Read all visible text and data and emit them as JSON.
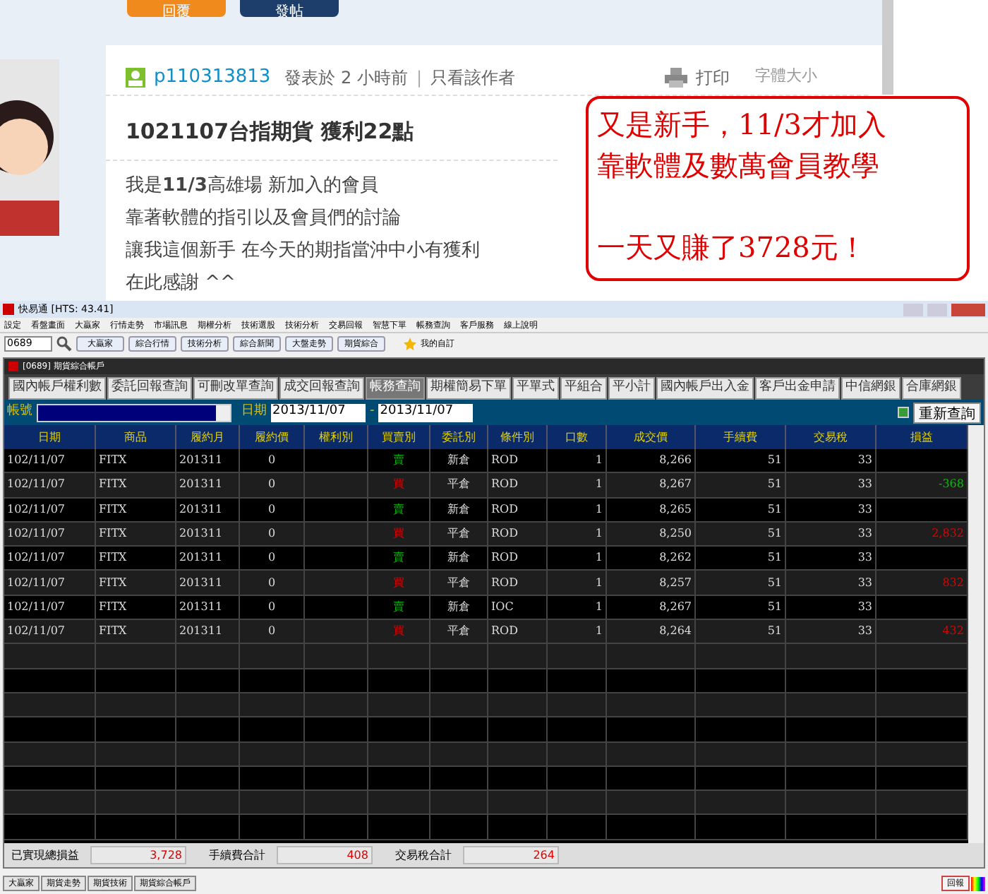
{
  "forum": {
    "buttons": [
      "回覆",
      "發帖"
    ],
    "post": {
      "author": "p110313813",
      "posted": "發表於 2 小時前",
      "divider": "|",
      "author_only": "只看該作者",
      "print": "打印",
      "font_size": "字體大小",
      "title": "1021107台指期貨 獲利22點",
      "body": [
        "我是**11/3**高雄場 新加入的會員",
        "靠著軟體的指引以及會員們的討論",
        "讓我這個新手 在今天的期指當沖中小有獲利",
        "在此感謝 ^^"
      ]
    },
    "callout": [
      "又是新手，11/3才加入",
      "靠軟體及數萬會員教學",
      "一天又賺了3728元！"
    ]
  },
  "app": {
    "title": "快易通 [HTS: 43.41]",
    "menu": [
      "設定",
      "看盤畫面",
      "大贏家",
      "行情走勢",
      "市場訊息",
      "期權分析",
      "技術選股",
      "技術分析",
      "交易回報",
      "智慧下單",
      "帳務查詢",
      "客戶服務",
      "線上說明"
    ],
    "symbol": "0689",
    "toolbar": [
      "大贏家",
      "綜合行情",
      "技術分析",
      "綜合新聞",
      "大盤走勢",
      "期貨綜合"
    ],
    "favorites": "我的自訂",
    "inner_title": "[0689] 期貨綜合帳戶",
    "tabs": [
      {
        "label": "國內帳戶權利數",
        "selected": false
      },
      {
        "label": "委託回報查詢",
        "selected": false
      },
      {
        "label": "可刪改單查詢",
        "selected": false
      },
      {
        "label": "成交回報查詢",
        "selected": false
      },
      {
        "label": "帳務查詢",
        "selected": true
      },
      {
        "label": "期權簡易下單",
        "selected": false
      },
      {
        "label": "平單式",
        "selected": false
      },
      {
        "label": "平組合",
        "selected": false
      },
      {
        "label": "平小計",
        "selected": false
      },
      {
        "label": "國內帳戶出入金",
        "selected": false
      },
      {
        "label": "客戶出金申請",
        "selected": false
      },
      {
        "label": "中信網銀",
        "selected": false
      },
      {
        "label": "合庫網銀",
        "selected": false
      }
    ],
    "filter": {
      "account_label": "帳號",
      "date_label": "日期",
      "date_from": "2013/11/07",
      "separator": "-",
      "date_to": "2013/11/07",
      "refresh": "重新查詢"
    },
    "columns": [
      "日期",
      "商品",
      "履約月",
      "履約價",
      "權利別",
      "買賣別",
      "委託別",
      "條件別",
      "口數",
      "成交價",
      "手續費",
      "交易稅",
      "損益"
    ],
    "rows": [
      {
        "date": "102/11/07",
        "product": "FITX",
        "month": "201311",
        "strike": "0",
        "side": {
          "text": "賣",
          "color": "#00c000"
        },
        "order": "新倉",
        "cond": "ROD",
        "qty": "1",
        "price": "8,266",
        "fee": "51",
        "tax": "33"
      },
      {
        "date": "102/11/07",
        "product": "FITX",
        "month": "201311",
        "strike": "0",
        "side": {
          "text": "買",
          "color": "#e00000"
        },
        "order": "平倉",
        "cond": "ROD",
        "qty": "1",
        "price": "8,267",
        "fee": "51",
        "tax": "33",
        "pnl": {
          "text": "-368",
          "color": "#00c000"
        }
      },
      {
        "date": "102/11/07",
        "product": "FITX",
        "month": "201311",
        "strike": "0",
        "side": {
          "text": "賣",
          "color": "#00c000"
        },
        "order": "新倉",
        "cond": "ROD",
        "qty": "1",
        "price": "8,265",
        "fee": "51",
        "tax": "33"
      },
      {
        "date": "102/11/07",
        "product": "FITX",
        "month": "201311",
        "strike": "0",
        "side": {
          "text": "買",
          "color": "#e00000"
        },
        "order": "平倉",
        "cond": "ROD",
        "qty": "1",
        "price": "8,250",
        "fee": "51",
        "tax": "33",
        "pnl": {
          "text": "2,832",
          "color": "#e00000"
        }
      },
      {
        "date": "102/11/07",
        "product": "FITX",
        "month": "201311",
        "strike": "0",
        "side": {
          "text": "賣",
          "color": "#00c000"
        },
        "order": "新倉",
        "cond": "ROD",
        "qty": "1",
        "price": "8,262",
        "fee": "51",
        "tax": "33"
      },
      {
        "date": "102/11/07",
        "product": "FITX",
        "month": "201311",
        "strike": "0",
        "side": {
          "text": "買",
          "color": "#e00000"
        },
        "order": "平倉",
        "cond": "ROD",
        "qty": "1",
        "price": "8,257",
        "fee": "51",
        "tax": "33",
        "pnl": {
          "text": "832",
          "color": "#e00000"
        }
      },
      {
        "date": "102/11/07",
        "product": "FITX",
        "month": "201311",
        "strike": "0",
        "side": {
          "text": "賣",
          "color": "#00c000"
        },
        "order": "新倉",
        "cond": "IOC",
        "qty": "1",
        "price": "8,267",
        "fee": "51",
        "tax": "33"
      },
      {
        "date": "102/11/07",
        "product": "FITX",
        "month": "201311",
        "strike": "0",
        "side": {
          "text": "買",
          "color": "#e00000"
        },
        "order": "平倉",
        "cond": "ROD",
        "qty": "1",
        "price": "8,264",
        "fee": "51",
        "tax": "33",
        "pnl": {
          "text": "432",
          "color": "#e00000"
        }
      }
    ],
    "totals": [
      {
        "label": "已實現總損益",
        "value": "3,728"
      },
      {
        "label": "手續費合計",
        "value": "408"
      },
      {
        "label": "交易稅合計",
        "value": "264"
      }
    ],
    "taskbar": [
      "大贏家",
      "期貨走勢",
      "期貨技術",
      "期貨綜合帳戶"
    ],
    "report": "回報"
  }
}
